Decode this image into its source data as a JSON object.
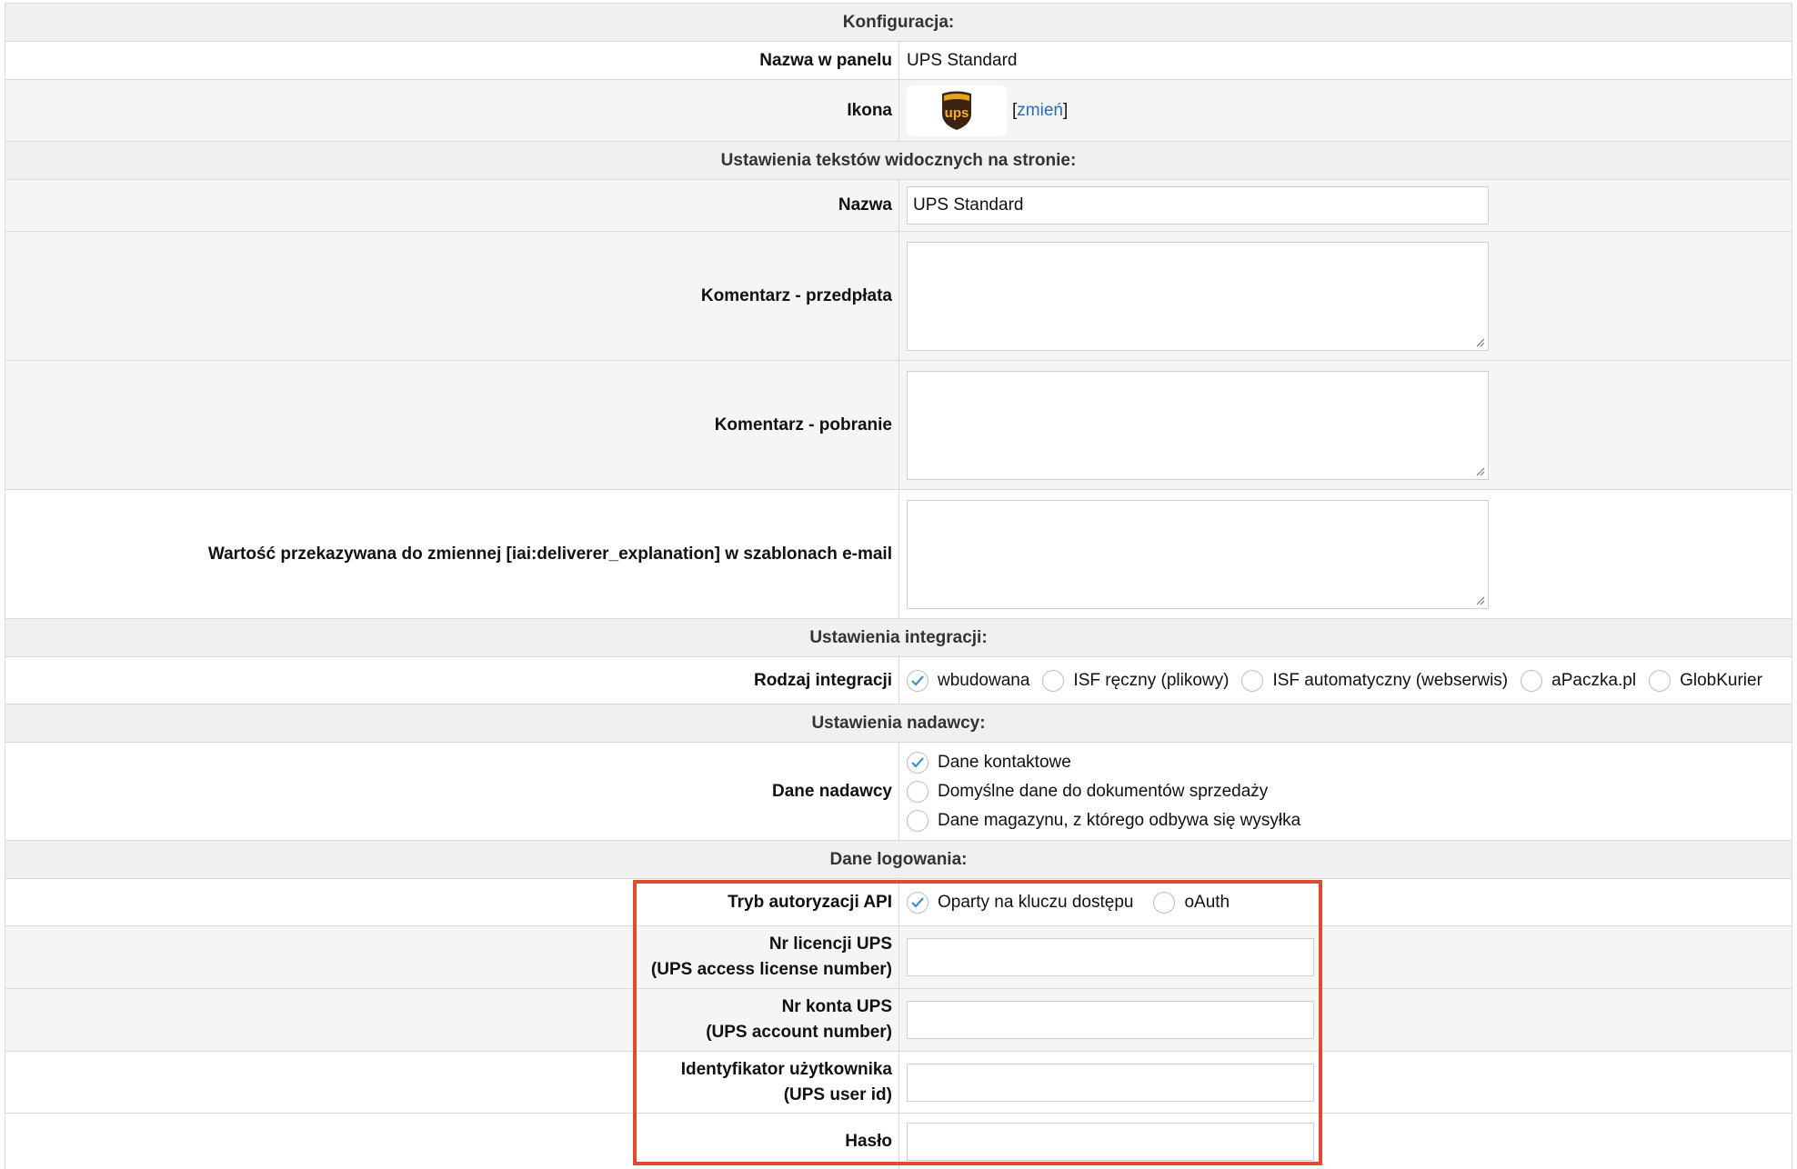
{
  "sections": {
    "config": "Konfiguracja:",
    "texts": "Ustawienia tekstów widocznych na stronie:",
    "integration": "Ustawienia integracji:",
    "sender": "Ustawienia nadawcy:",
    "login": "Dane logowania:"
  },
  "config": {
    "panel_name_label": "Nazwa w panelu",
    "panel_name_value": "UPS Standard",
    "icon_label": "Ikona",
    "icon_logo_text": "ups",
    "change_bracket_open": "[",
    "change_link": "zmień",
    "change_bracket_close": "]"
  },
  "texts": {
    "name_label": "Nazwa",
    "name_value": "UPS Standard",
    "comment_prepaid_label": "Komentarz - przedpłata",
    "comment_cod_label": "Komentarz - pobranie",
    "email_var_label": "Wartość przekazywana do zmiennej [iai:deliverer_explanation] w szablonach e-mail"
  },
  "integration": {
    "type_label": "Rodzaj integracji",
    "options": [
      "wbudowana",
      "ISF ręczny (plikowy)",
      "ISF automatyczny (webserwis)",
      "aPaczka.pl",
      "GlobKurier"
    ],
    "selected": "wbudowana"
  },
  "sender": {
    "label": "Dane nadawcy",
    "options": [
      "Dane kontaktowe",
      "Domyślne dane do dokumentów sprzedaży",
      "Dane magazynu, z którego odbywa się wysyłka"
    ],
    "selected": "Dane kontaktowe"
  },
  "login": {
    "auth_label": "Tryb autoryzacji API",
    "auth_options": [
      "Oparty na kluczu dostępu",
      "oAuth"
    ],
    "auth_selected": "Oparty na kluczu dostępu",
    "license_label_1": "Nr licencji UPS",
    "license_label_2": "(UPS access license number)",
    "account_label_1": "Nr konta UPS",
    "account_label_2": "(UPS account number)",
    "user_label_1": "Identyfikator użytkownika",
    "user_label_2": "(UPS user id)",
    "password_label": "Hasło"
  },
  "colors": {
    "highlight_border": "#e04a33",
    "check_color": "#3a8fd0",
    "link_color": "#2a6db5",
    "ups_brown": "#3b2314",
    "ups_gold": "#f5b321"
  }
}
